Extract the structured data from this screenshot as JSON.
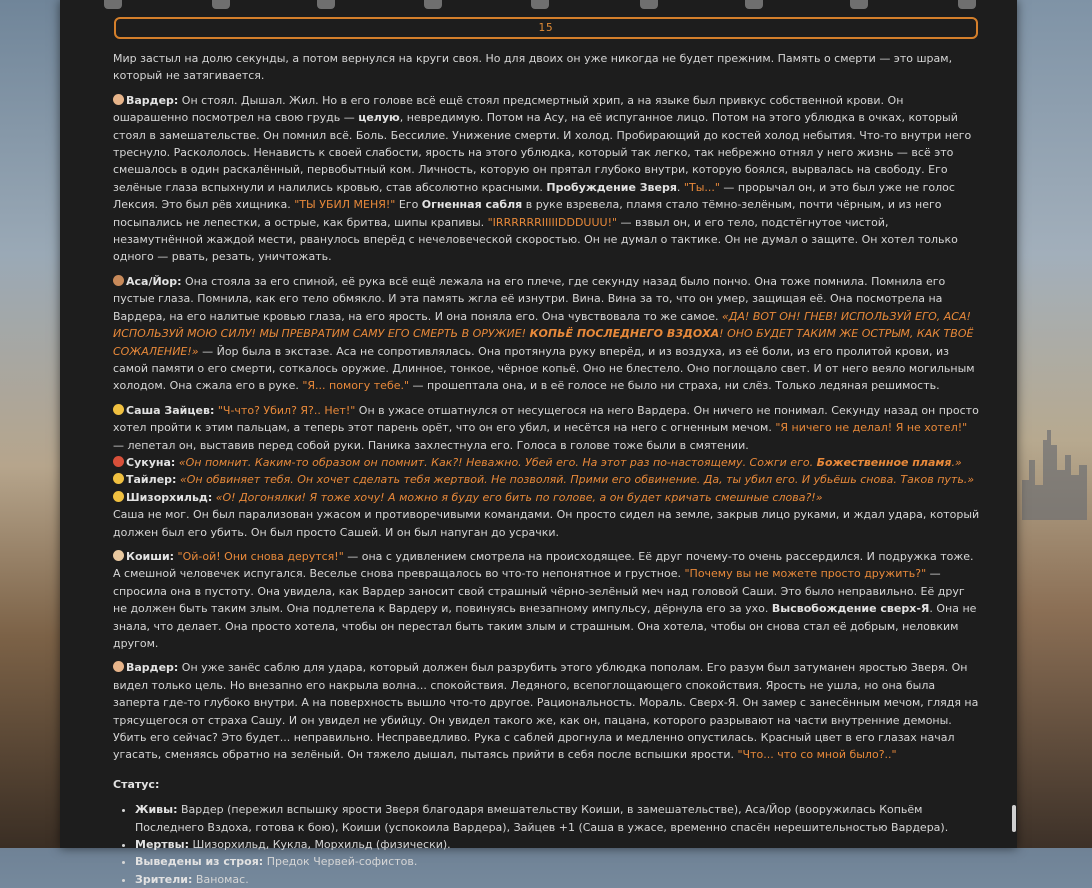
{
  "counter": "15",
  "colors": {
    "accent": "#e8893a",
    "panel": "#1d1d1d",
    "text": "#d6d6d6"
  },
  "toolbar_icons": [
    "settings-icon",
    "pin-icon",
    "text-icon",
    "book-icon",
    "gear-icon",
    "image-icon",
    "dice-icon",
    "emoji-icon",
    "save-icon"
  ],
  "p0": "Мир застыл на долю секунды, а потом вернулся на круги своя. Но для двоих он уже никогда не будет прежним. Память о смерти — это шрам, который не затягивается.",
  "p1": {
    "name": "Вардер:",
    "t1": " Он стоял. Дышал. Жил. Но в его голове всё ещё стоял предсмертный хрип, а на языке был привкус собственной крови. Он ошарашенно посмотрел на свою грудь — ",
    "b1": "целую",
    "t2": ", невредимую. Потом на Асу, на её испуганное лицо. Потом на этого ублюдка в очках, который стоял в замешательстве. Он помнил всё. Боль. Бессилие. Унижение смерти. И холод. Пробирающий до костей холод небытия. Что-то внутри него треснуло. Раскололось. Ненависть к своей слабости, ярость на этого ублюдка, который так легко, так небрежно отнял у него жизнь — всё это смешалось в один раскалённый, первобытный ком. Личность, которую он прятал глубоко внутри, которую боялся, вырвалась на свободу. Его зелёные глаза вспыхнули и налились кровью, став абсолютно красными. ",
    "b2": "Пробуждение Зверя",
    "t3": ". ",
    "q1": "\"Ты...\"",
    "t4": " — прорычал он, и это был уже не голос Лексия. Это был рёв хищника. ",
    "q2": "\"ТЫ УБИЛ МЕНЯ!\"",
    "t5": " Его ",
    "b3": "Огненная сабля",
    "t6": " в руке взревела, пламя стало тёмно-зелёным, почти чёрным, и из него посыпались не лепестки, а острые, как бритва, шипы крапивы. ",
    "q3": "\"IRRRRRRIIIIIDDDUUU!\"",
    "t7": " — взвыл он, и его тело, подстёгнутое чистой, незамутнённой жаждой мести, рванулось вперёд с нечеловеческой скоростью. Он не думал о тактике. Он не думал о защите. Он хотел только одного — рвать, резать, уничтожать."
  },
  "p2": {
    "name": "Аса/Йор:",
    "t1": " Она стояла за его спиной, её рука всё ещё лежала на его плече, где секунду назад было пончо. Она тоже помнила. Помнила его пустые глаза. Помнила, как его тело обмякло. И эта память жгла её изнутри. Вина. Вина за то, что он умер, защищая её. Она посмотрела на Вардера, на его налитые кровью глаза, на его ярость. И она поняла его. Она чувствовала то же самое. ",
    "i1": "«ДА! ВОТ ОН! ГНЕВ! ИСПОЛЬЗУЙ ЕГО, АСА! ИСПОЛЬЗУЙ МОЮ СИЛУ! МЫ ПРЕВРАТИМ САМУ ЕГО СМЕРТЬ В ОРУЖИЕ! ",
    "ib1": "КОПЬЁ ПОСЛЕДНЕГО ВЗДОХА",
    "i2": "! ОНО БУДЕТ ТАКИМ ЖЕ ОСТРЫМ, КАК ТВОЁ СОЖАЛЕНИЕ!»",
    "t2": " — Йор была в экстазе. Аса не сопротивлялась. Она протянула руку вперёд, и из воздуха, из её боли, из его пролитой крови, из самой памяти о его смерти, соткалось оружие. Длинное, тонкое, чёрное копьё. Оно не блестело. Оно поглощало свет. И от него веяло могильным холодом. Она сжала его в руке. ",
    "q1": "\"Я... помогу тебе.\"",
    "t3": " — прошептала она, и в её голосе не было ни страха, ни слёз. Только ледяная решимость."
  },
  "p3": {
    "name": "Саша Зайцев:",
    "q1": "\"Ч-что? Убил? Я?.. Нет!\"",
    "t1": " Он в ужасе отшатнулся от несущегося на него Вардера. Он ничего не понимал. Секунду назад он просто хотел пройти к этим пальцам, а теперь этот парень орёт, что он его убил, и несётся на него с огненным мечом. ",
    "q2": "\"Я ничего не делал! Я не хотел!\"",
    "t2": " — лепетал он, выставив перед собой руки. Паника захлестнула его. Голоса в голове тоже были в смятении.",
    "l1name": "Сукуна:",
    "l1i": "«Он помнит. Каким-то образом он помнит. Как?! Неважно. Убей его. На этот раз по-настоящему. Сожги его. ",
    "l1ib": "Божественное пламя",
    "l1end": ".»",
    "l2name": "Тайлер:",
    "l2i": "«Он обвиняет тебя. Он хочет сделать тебя жертвой. Не позволяй. Прими его обвинение. Да, ты убил его. И убьёшь снова. Таков путь.»",
    "l3name": "Шизорхильд:",
    "l3i": "«О! Догонялки! Я тоже хочу! А можно я буду его бить по голове, а он будет кричать смешные слова?!»",
    "t3": "Саша не мог. Он был парализован ужасом и противоречивыми командами. Он просто сидел на земле, закрыв лицо руками, и ждал удара, который должен был его убить. Он был просто Сашей. И он был напуган до усрачки."
  },
  "p4": {
    "name": "Коиши:",
    "q1": "\"Ой-ой! Они снова дерутся!\"",
    "t1": " — она с удивлением смотрела на происходящее. Её друг почему-то очень рассердился. И подружка тоже. А смешной человечек испугался. Веселье снова превращалось во что-то непонятное и грустное. ",
    "q2": "\"Почему вы не можете просто дружить?\"",
    "t2": " — спросила она в пустоту. Она увидела, как Вардер заносит свой страшный чёрно-зелёный меч над головой Саши. Это было неправильно. Её друг не должен быть таким злым. Она подлетела к Вардеру и, повинуясь внезапному импульсу, дёрнула его за ухо. ",
    "b1": "Высвобождение сверх-Я",
    "t3": ". Она не знала, что делает. Она просто хотела, чтобы он перестал быть таким злым и страшным. Она хотела, чтобы он снова стал её добрым, неловким другом."
  },
  "p5": {
    "name": "Вардер:",
    "t1": " Он уже занёс саблю для удара, который должен был разрубить этого ублюдка пополам. Его разум был затуманен яростью Зверя. Он видел только цель. Но внезапно его накрыла волна... спокойствия. Ледяного, всепоглощающего спокойствия. Ярость не ушла, но она была заперта где-то глубоко внутри. А на поверхность вышло что-то другое. Рациональность. Мораль. Сверх-Я. Он замер с занесённым мечом, глядя на трясущегося от страха Сашу. И он увидел не убийцу. Он увидел такого же, как он, пацана, которого разрывают на части внутренние демоны. Убить его сейчас? Это будет... неправильно. Несправедливо. Рука с саблей дрогнула и медленно опустилась. Красный цвет в его глазах начал угасать, сменяясь обратно на зелёный. Он тяжело дышал, пытаясь прийти в себя после вспышки ярости. ",
    "q1": "\"Что... что со мной было?..\""
  },
  "status": {
    "title": "Статус:",
    "items": [
      {
        "label": "Живы:",
        "text": " Вардер (пережил вспышку ярости Зверя благодаря вмешательству Коиши, в замешательстве), Аса/Йор (вооружилась Копьём Последнего Вздоха, готова к бою), Коиши (успокоила Вардера), Зайцев +1 (Саша в ужасе, временно спасён нерешительностью Вардера)."
      },
      {
        "label": "Мертвы:",
        "text": " Шизорхильд, Кукла, Морхильд (физически)."
      },
      {
        "label": "Выведены из строя:",
        "text": " Предок Червей-софистов."
      },
      {
        "label": "Зрители:",
        "text": " Ваномас."
      }
    ]
  }
}
